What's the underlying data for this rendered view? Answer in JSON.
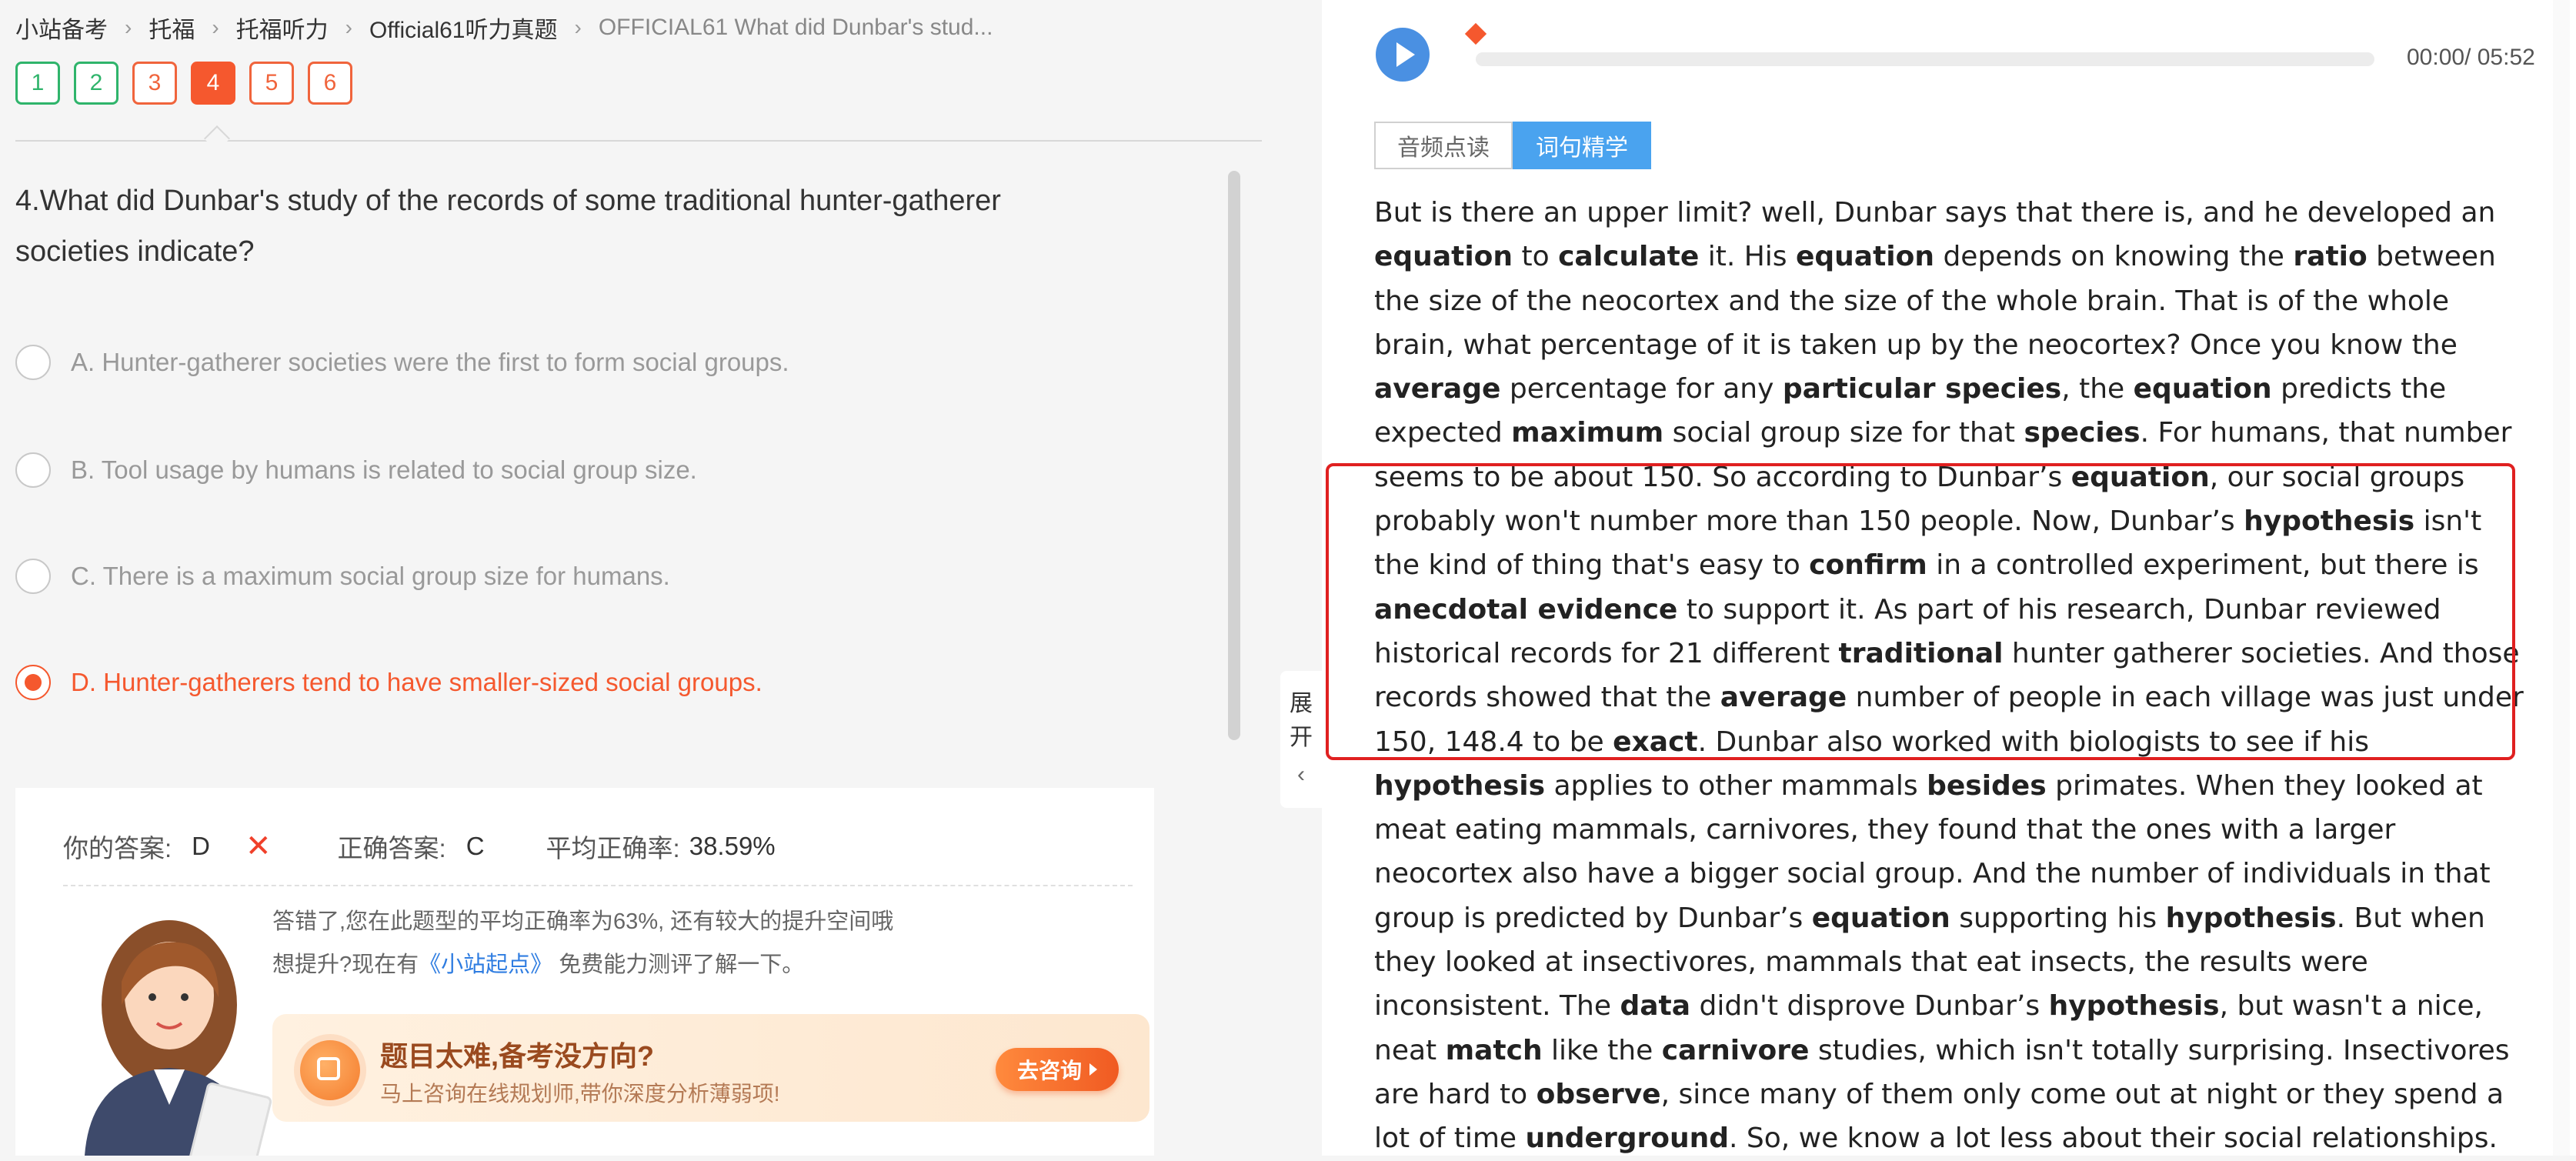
{
  "breadcrumb": [
    "小站备考",
    "托福",
    "托福听力",
    "Official61听力真题",
    "OFFICIAL61 What did Dunbar's stud..."
  ],
  "question_numbers": [
    {
      "label": "1",
      "state": "correct"
    },
    {
      "label": "2",
      "state": "correct"
    },
    {
      "label": "3",
      "state": "wrong"
    },
    {
      "label": "4",
      "state": "active"
    },
    {
      "label": "5",
      "state": "wrong"
    },
    {
      "label": "6",
      "state": "wrong"
    }
  ],
  "question": {
    "text": "4.What did Dunbar's study of the records of some traditional hunter-gatherer societies indicate?",
    "options": [
      "A. Hunter-gatherer societies were the first to form social groups.",
      "B. Tool usage by humans is related to social group size.",
      "C. There is a maximum social group size for humans.",
      "D. Hunter-gatherers tend to have smaller-sized social groups."
    ],
    "selected_index": 3
  },
  "answer": {
    "your_label": "你的答案:",
    "your_value": "D",
    "wrong_mark": "✕",
    "correct_label": "正确答案:",
    "correct_value": "C",
    "avg_label": "平均正确率:",
    "avg_value": "38.59%",
    "feedback_line1": "答错了,您在此题型的平均正确率为63%, 还有较大的提升空间哦",
    "feedback_line2_pre": "想提升?现在有",
    "feedback_line2_link": "《小站起点》",
    "feedback_line2_post": " 免费能力测评了解一下。"
  },
  "promo": {
    "title": "题目太难,备考没方向?",
    "subtitle": "马上咨询在线规划师,带你深度分析薄弱项!",
    "button": "去咨询"
  },
  "expand_tab": {
    "line1": "展",
    "line2": "开",
    "chevron": "‹"
  },
  "player": {
    "time": "00:00/ 05:52",
    "progress": 0
  },
  "tabs": [
    "音频点读",
    "词句精学"
  ],
  "active_tab": 1,
  "transcript_segments": [
    {
      "t": "But is there an upper limit? well, Dunbar says that there is, and he developed an "
    },
    {
      "t": "equation",
      "b": true
    },
    {
      "t": " to "
    },
    {
      "t": "calculate",
      "b": true
    },
    {
      "t": " it. His "
    },
    {
      "t": "equation",
      "b": true
    },
    {
      "t": " depends on knowing the "
    },
    {
      "t": "ratio",
      "b": true
    },
    {
      "t": " between the size of the neocortex and the size of the whole brain. That is of the whole brain, what percentage of it is taken up by the neocortex? Once you know the "
    },
    {
      "t": "average",
      "b": true
    },
    {
      "t": " percentage for any "
    },
    {
      "t": "particular species",
      "b": true
    },
    {
      "t": ", the "
    },
    {
      "t": "equation",
      "b": true
    },
    {
      "t": " predicts the expected "
    },
    {
      "t": "maximum",
      "b": true
    },
    {
      "t": " social group size for that "
    },
    {
      "t": "species",
      "b": true
    },
    {
      "t": ". For humans, that number seems to be about 150. So according to Dunbar’s "
    },
    {
      "t": "equation",
      "b": true
    },
    {
      "t": ", our social groups probably won't number more than 150 people. Now, Dunbar’s "
    },
    {
      "t": "hypothesis",
      "b": true
    },
    {
      "t": " isn't the kind of thing that's easy to "
    },
    {
      "t": "confirm",
      "b": true
    },
    {
      "t": " in a controlled experiment, but there is "
    },
    {
      "t": "anecdotal evidence",
      "b": true
    },
    {
      "t": " to support it. As part of his research, Dunbar reviewed historical records for 21 different "
    },
    {
      "t": "traditional",
      "b": true
    },
    {
      "t": " hunter gatherer societies. And those records showed that the "
    },
    {
      "t": "average",
      "b": true
    },
    {
      "t": " number of people in each village was just under 150, 148.4 to be "
    },
    {
      "t": "exact",
      "b": true
    },
    {
      "t": ". Dunbar also worked with biologists to see if his "
    },
    {
      "t": "hypothesis",
      "b": true
    },
    {
      "t": " applies to other mammals "
    },
    {
      "t": "besides",
      "b": true
    },
    {
      "t": " primates. When they looked at meat eating mammals, carnivores, they found that the ones with a larger neocortex also have a bigger social group. And the number of individuals in that group is predicted by Dunbar’s "
    },
    {
      "t": "equation",
      "b": true
    },
    {
      "t": " supporting his "
    },
    {
      "t": "hypothesis",
      "b": true
    },
    {
      "t": ". But when they looked at insectivores, mammals that eat insects, the results were inconsistent. The "
    },
    {
      "t": "data",
      "b": true
    },
    {
      "t": " didn't disprove Dunbar’s "
    },
    {
      "t": "hypothesis",
      "b": true
    },
    {
      "t": ", but wasn't a nice, neat "
    },
    {
      "t": "match",
      "b": true
    },
    {
      "t": " like the "
    },
    {
      "t": "carnivore",
      "b": true
    },
    {
      "t": " studies, which isn't totally surprising. Insectivores are hard to "
    },
    {
      "t": "observe",
      "b": true
    },
    {
      "t": ", since many of them only come out at night or they spend a lot of time "
    },
    {
      "t": "underground",
      "b": true
    },
    {
      "t": ". So, we know a lot less about their social relationships."
    }
  ],
  "colors": {
    "accent": "#f5582e",
    "correct": "#2fb46b",
    "tab_active": "#4aa3ef",
    "play": "#4a90e2",
    "highlight_box": "#e02020"
  }
}
